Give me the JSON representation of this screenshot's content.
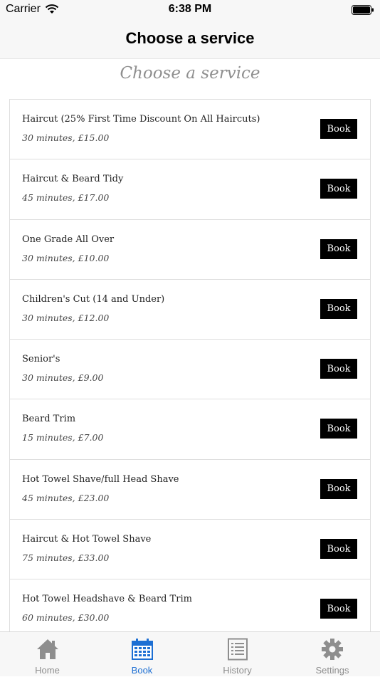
{
  "status_bar": {
    "carrier": "Carrier",
    "time": "6:38 PM"
  },
  "nav": {
    "title": "Choose a service"
  },
  "page": {
    "heading": "Choose a service"
  },
  "services": [
    {
      "name": "Haircut (25% First Time Discount On All Haircuts)",
      "meta": "30 minutes, £15.00",
      "button": "Book"
    },
    {
      "name": "Haircut & Beard Tidy",
      "meta": "45 minutes, £17.00",
      "button": "Book"
    },
    {
      "name": "One Grade All Over",
      "meta": "30 minutes, £10.00",
      "button": "Book"
    },
    {
      "name": "Children's Cut (14 and Under)",
      "meta": "30 minutes, £12.00",
      "button": "Book"
    },
    {
      "name": "Senior's",
      "meta": "30 minutes, £9.00",
      "button": "Book"
    },
    {
      "name": "Beard Trim",
      "meta": "15 minutes, £7.00",
      "button": "Book"
    },
    {
      "name": "Hot Towel Shave/full Head Shave",
      "meta": "45 minutes, £23.00",
      "button": "Book"
    },
    {
      "name": "Haircut & Hot Towel Shave",
      "meta": "75 minutes, £33.00",
      "button": "Book"
    },
    {
      "name": "Hot Towel Headshave & Beard Trim",
      "meta": "60 minutes, £30.00",
      "button": "Book"
    }
  ],
  "tabs": [
    {
      "label": "Home",
      "icon": "home-icon"
    },
    {
      "label": "Book",
      "icon": "calendar-icon"
    },
    {
      "label": "History",
      "icon": "list-icon"
    },
    {
      "label": "Settings",
      "icon": "gear-icon"
    }
  ],
  "colors": {
    "accent": "#1d6fd3",
    "inactive": "#8e8e8e",
    "button_bg": "#000000",
    "heading": "#8f8f8f"
  }
}
